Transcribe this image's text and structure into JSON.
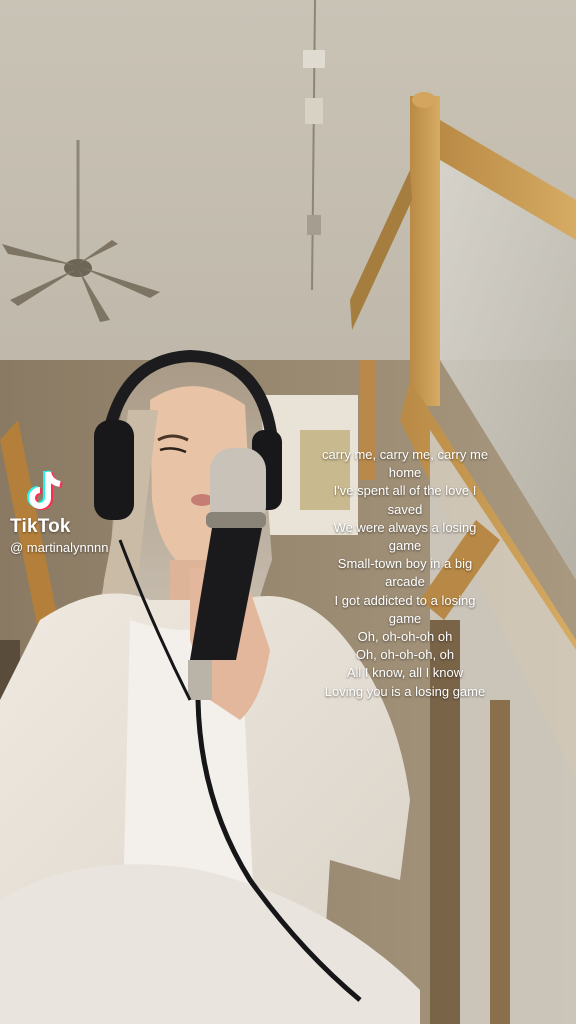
{
  "branding": {
    "app_name": "TikTok",
    "username": "@ martinalynnnn",
    "logo_icon": "tiktok-note-icon"
  },
  "lyrics": [
    "carry me, carry me, carry me home",
    "I've spent all of the love I saved",
    "We were always a losing game",
    "Small-town boy in a big arcade",
    "I got addicted to a losing game",
    "Oh, oh-oh-oh oh",
    "Oh, oh-oh-oh, oh",
    "All I know, all I know",
    "Loving you is a losing game"
  ],
  "colors": {
    "text": "#ffffff",
    "tiktok_cyan": "#25f4ee",
    "tiktok_red": "#fe2c55"
  }
}
